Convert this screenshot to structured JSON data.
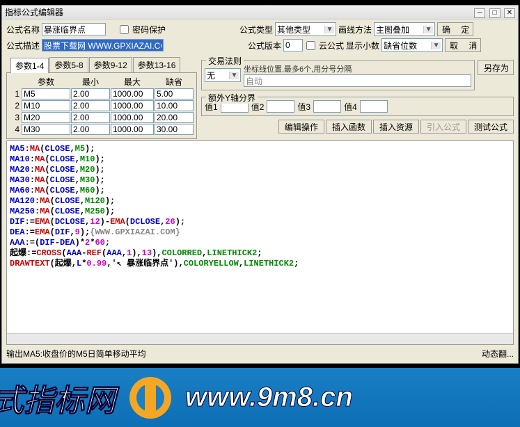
{
  "window": {
    "title": "指标公式编辑器"
  },
  "row1": {
    "name_lbl": "公式名称",
    "name_val": "暴涨临界点",
    "pwd_lbl": "密码保护",
    "type_lbl": "公式类型",
    "type_val": "其他类型",
    "draw_lbl": "画线方法",
    "draw_val": "主图叠加",
    "ok": "确 定"
  },
  "row2": {
    "desc_lbl": "公式描述",
    "desc_val": "股票下载网 WWW.GPXIAZAI.COM",
    "ver_lbl": "公式版本",
    "ver_val": "0",
    "cloud_lbl": "云公式",
    "dec_lbl": "显示小数",
    "dec_val": "缺省位数",
    "cancel": "取 消"
  },
  "tabs": [
    "参数1-4",
    "参数5-8",
    "参数9-12",
    "参数13-16"
  ],
  "phdr": {
    "p": "参数",
    "mn": "最小",
    "mx": "最大",
    "df": "缺省"
  },
  "params": [
    {
      "n": "1",
      "name": "M5",
      "min": "2.00",
      "max": "1000.00",
      "def": "5.00"
    },
    {
      "n": "2",
      "name": "M10",
      "min": "2.00",
      "max": "1000.00",
      "def": "10.00"
    },
    {
      "n": "3",
      "name": "M20",
      "min": "2.00",
      "max": "1000.00",
      "def": "20.00"
    },
    {
      "n": "4",
      "name": "M30",
      "min": "2.00",
      "max": "1000.00",
      "def": "30.00"
    }
  ],
  "trade": {
    "legend": "交易法则",
    "note": "坐标线位置,最多6个,用分号分隔",
    "sel": "无",
    "auto": "自动",
    "saveas": "另存为"
  },
  "yaxis": {
    "legend": "额外Y轴分界",
    "v1": "值1",
    "v2": "值2",
    "v3": "值3",
    "v4": "值4"
  },
  "btns": {
    "edit": "编辑操作",
    "func": "插入函数",
    "res": "插入资源",
    "import": "引入公式",
    "test": "测试公式"
  },
  "status": {
    "left": "输出MA5:收盘价的M5日简单移动平均",
    "right": "动态翻..."
  },
  "banner": {
    "cn": "式指标网",
    "url": "www.9m8.cn"
  }
}
